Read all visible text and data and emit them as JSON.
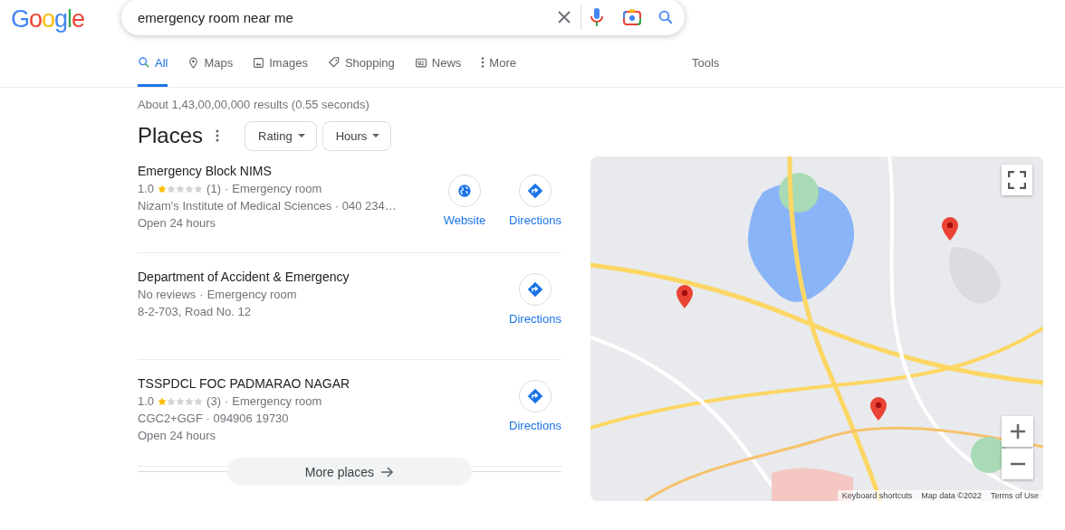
{
  "logo": "Google",
  "search": {
    "value": "emergency room near me"
  },
  "tabs": [
    {
      "label": "All",
      "selected": true
    },
    {
      "label": "Maps",
      "selected": false
    },
    {
      "label": "Images",
      "selected": false
    },
    {
      "label": "Shopping",
      "selected": false
    },
    {
      "label": "News",
      "selected": false
    },
    {
      "label": "More",
      "selected": false
    }
  ],
  "tools": "Tools",
  "result_stats": "About 1,43,00,00,000 results (0.55 seconds)",
  "places": {
    "title": "Places",
    "filters": [
      "Rating",
      "Hours"
    ],
    "items": [
      {
        "name": "Emergency Block NIMS",
        "rating": "1.0",
        "stars": 1,
        "reviews": "(1)",
        "separator": "·",
        "category": "Emergency room",
        "lines": [
          "Nizam's Institute of Medical Sciences · 040 234…",
          "Open 24 hours"
        ],
        "actions": [
          {
            "kind": "website",
            "label": "Website"
          },
          {
            "kind": "directions",
            "label": "Directions"
          }
        ]
      },
      {
        "name": "Department of Accident & Emergency",
        "rating_text": "No reviews",
        "separator": "·",
        "category": "Emergency room",
        "lines": [
          "8-2-703, Road No. 12"
        ],
        "actions": [
          {
            "kind": "directions",
            "label": "Directions"
          }
        ]
      },
      {
        "name": "TSSPDCL FOC PADMARAO NAGAR",
        "rating": "1.0",
        "stars": 1,
        "reviews": "(3)",
        "separator": "·",
        "category": "Emergency room",
        "lines": [
          "CGC2+GGF · 094906 19730",
          "Open 24 hours"
        ],
        "actions": [
          {
            "kind": "directions",
            "label": "Directions"
          }
        ]
      }
    ],
    "more": "More places"
  },
  "map": {
    "kind": "picture",
    "footer": [
      "Keyboard shortcuts",
      "Map data ©2022",
      "Terms of Use"
    ]
  }
}
